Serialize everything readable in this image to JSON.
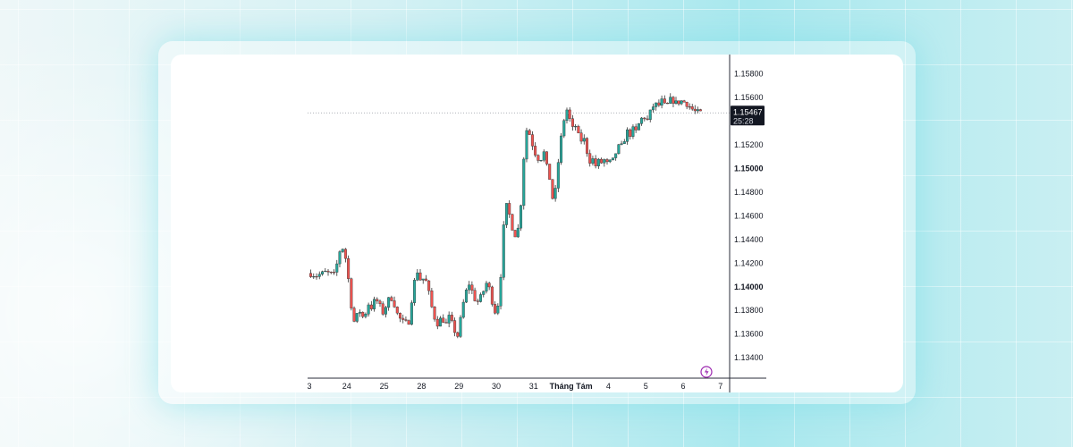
{
  "chart_data": {
    "type": "candlestick",
    "x_ticks": [
      "3",
      "24",
      "25",
      "28",
      "29",
      "30",
      "31",
      "Tháng Tám",
      "4",
      "5",
      "6",
      "7"
    ],
    "y_ticks": [
      "1.15800",
      "1.15600",
      "1.15400",
      "1.15200",
      "1.15000",
      "1.14800",
      "1.14600",
      "1.14400",
      "1.14200",
      "1.14000",
      "1.13800",
      "1.13600",
      "1.13400"
    ],
    "y_bold_ticks": [
      "1.15000",
      "1.14000"
    ],
    "ylim": [
      1.1331,
      1.159
    ],
    "current_price": {
      "value": "1.15467",
      "countdown": "25:28"
    },
    "colors": {
      "up": "#26a69a",
      "down": "#ef5350",
      "wick": "#333333",
      "label_bg": "#131722",
      "grid_line": "#9598a1"
    },
    "series": [
      {
        "day": "3",
        "x_range": [
          0,
          0.7
        ],
        "points": [
          1.1411,
          1.1409,
          1.1412,
          1.141
        ]
      },
      {
        "day": "24",
        "x_range": [
          0.7,
          1.7
        ],
        "points": [
          1.141,
          1.1417,
          1.1428,
          1.1434,
          1.143,
          1.142,
          1.1402,
          1.1382,
          1.137,
          1.1374,
          1.138,
          1.1377,
          1.1372,
          1.138,
          1.1386,
          1.1382
        ]
      },
      {
        "day": "25",
        "x_range": [
          1.7,
          2.7
        ],
        "points": [
          1.1382,
          1.1389,
          1.1386,
          1.1377,
          1.1384,
          1.1392,
          1.1386,
          1.1376,
          1.1371,
          1.1369,
          1.137
        ]
      },
      {
        "day": "28",
        "x_range": [
          2.7,
          3.7
        ],
        "points": [
          1.137,
          1.1384,
          1.1398,
          1.1408,
          1.1413,
          1.1407,
          1.1402,
          1.141,
          1.1403,
          1.1396,
          1.1386,
          1.1378,
          1.1372,
          1.1368,
          1.1371,
          1.1374,
          1.137,
          1.1368
        ]
      },
      {
        "day": "29",
        "x_range": [
          3.7,
          4.7
        ],
        "points": [
          1.1368,
          1.1374,
          1.1369,
          1.1362,
          1.1358,
          1.1372,
          1.1386,
          1.1396,
          1.1402,
          1.1396,
          1.1389,
          1.1387,
          1.1391,
          1.1396
        ]
      },
      {
        "day": "30",
        "x_range": [
          4.7,
          5.7
        ],
        "points": [
          1.1396,
          1.1403,
          1.1402,
          1.1398,
          1.139,
          1.1382,
          1.1378,
          1.1383,
          1.1388,
          1.1416,
          1.1446,
          1.1464,
          1.147,
          1.1462,
          1.1452,
          1.1448,
          1.1444,
          1.1438,
          1.1458,
          1.147
        ]
      },
      {
        "day": "31",
        "x_range": [
          5.7,
          6.7
        ],
        "points": [
          1.147,
          1.1498,
          1.1526,
          1.1534,
          1.153,
          1.1522,
          1.1518,
          1.1512,
          1.151,
          1.1504,
          1.151,
          1.1514,
          1.1504,
          1.1498,
          1.149,
          1.1476,
          1.147,
          1.1488,
          1.1505
        ]
      },
      {
        "day": "Tháng Tám",
        "x_range": [
          6.7,
          7.7
        ],
        "points": [
          1.1505,
          1.1524,
          1.1536,
          1.1552,
          1.1546,
          1.1538,
          1.1532,
          1.1536,
          1.1528,
          1.1522,
          1.1528,
          1.1518,
          1.151,
          1.1504,
          1.1508,
          1.1502
        ]
      },
      {
        "day": "4",
        "x_range": [
          7.7,
          8.7
        ],
        "points": [
          1.1502,
          1.1506,
          1.1504,
          1.1508,
          1.1503,
          1.1506,
          1.1504,
          1.151,
          1.1515,
          1.152,
          1.1518,
          1.1526,
          1.1532,
          1.1528,
          1.1533
        ]
      },
      {
        "day": "5",
        "x_range": [
          8.7,
          9.7
        ],
        "points": [
          1.1533,
          1.153,
          1.1536,
          1.154,
          1.1544,
          1.1542,
          1.154,
          1.1548,
          1.1552,
          1.1555,
          1.155,
          1.1558,
          1.1556,
          1.1552,
          1.1554,
          1.1558
        ]
      },
      {
        "day": "6",
        "x_range": [
          9.7,
          10.5
        ],
        "points": [
          1.1558,
          1.1555,
          1.1557,
          1.1553,
          1.1548,
          1.1547
        ]
      }
    ]
  }
}
